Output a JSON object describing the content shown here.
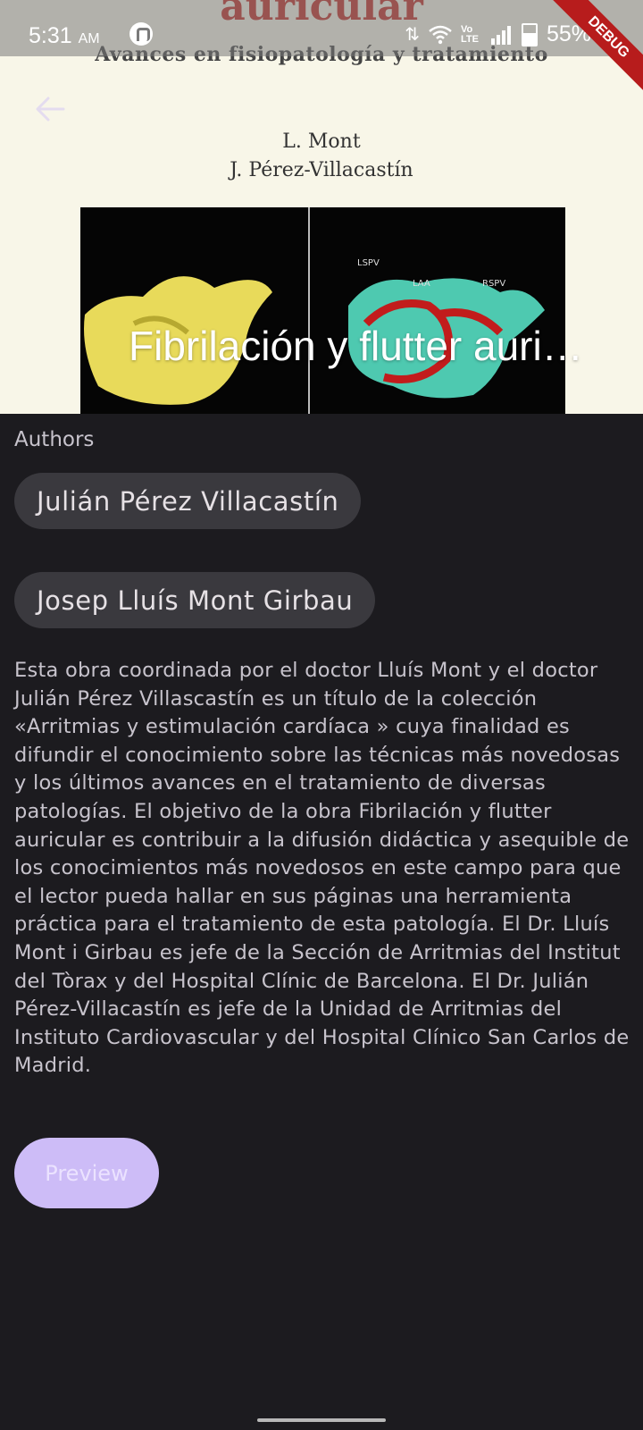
{
  "status_bar": {
    "time": "5:31",
    "ampm": "AM",
    "battery": "55%",
    "volte": "Vo LTE",
    "debug_banner": "DEBUG",
    "icons": [
      "app-notification-icon",
      "data-arrows-icon",
      "wifi-icon",
      "volte-icon",
      "signal-icon",
      "battery-icon"
    ]
  },
  "cover": {
    "title": "auricular",
    "subtitle": "Avances en fisiopatología y tratamiento",
    "authors": [
      "L. Mont",
      "J. Pérez-Villacastín"
    ]
  },
  "header": {
    "back_icon": "arrow-left-icon",
    "title": "Fibrilación y flutter auricular"
  },
  "authors_section": {
    "label": "Authors",
    "authors": [
      "Julián Pérez Villacastín",
      "Josep Lluís Mont Girbau"
    ]
  },
  "description": "Esta obra coordinada por el doctor Lluís Mont y el doctor Julián Pérez Villascastín es un título de la colección «Arritmias y estimulación cardíaca » cuya finalidad es difundir el conocimiento sobre las técnicas más novedosas y los últimos avances en el tratamiento de diversas patologías. El objetivo de la obra Fibrilación y flutter auricular es contribuir a la difusión didáctica y asequible de los conocimientos más novedosos en este campo para que el lector pueda hallar en sus páginas una herramienta práctica para el tratamiento de esta patología. El Dr. Lluís Mont i Girbau es jefe de la Sección de Arritmias del Institut del Tòrax y del Hospital Clínic de Barcelona. El Dr. Julián Pérez-Villacastín es jefe de la Unidad de Arritmias del Instituto Cardiovascular y del Hospital Clínico San Carlos de Madrid.",
  "actions": {
    "preview_label": "Preview"
  },
  "colors": {
    "background": "#1c1b1f",
    "chip": "#3a393e",
    "preview_button": "#cdbcf7",
    "cover_title": "#c0261f"
  }
}
